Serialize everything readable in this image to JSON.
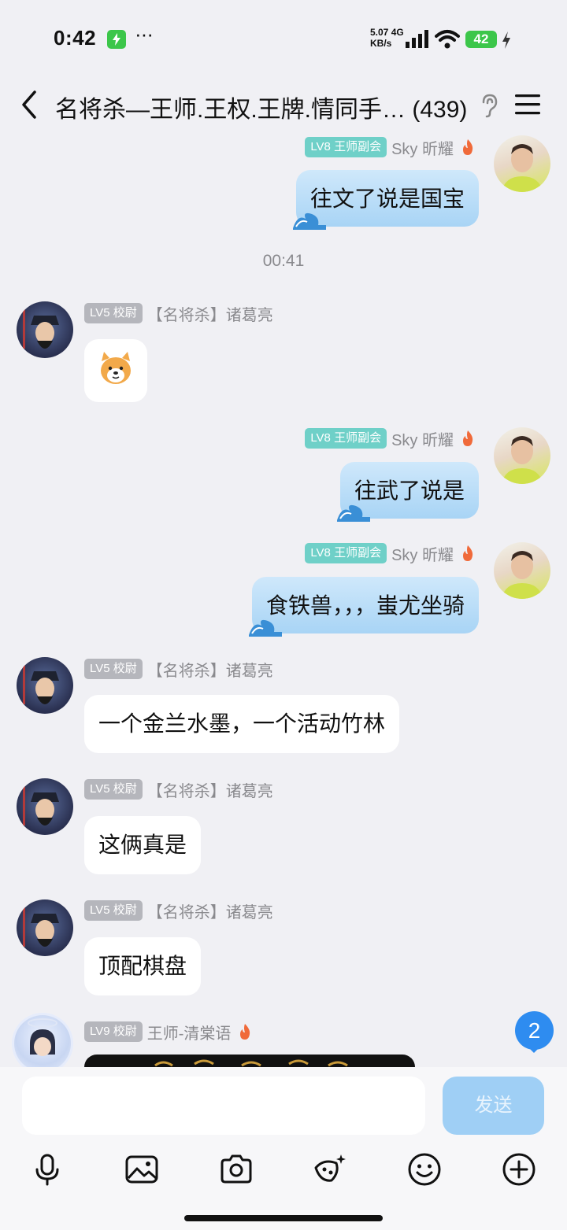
{
  "status_bar": {
    "time": "0:42",
    "dots": "···",
    "net_speed_value": "5.07",
    "net_speed_unit": "KB/s",
    "network_type": "4G",
    "battery": "42"
  },
  "header": {
    "title": "名将杀—王师.王权.王牌.情同手…",
    "member_count": "(439)"
  },
  "timestamp": "00:41",
  "users": {
    "sky": {
      "level": "LV8",
      "rank": "王师副会",
      "name": "Sky 昕耀"
    },
    "zhuge": {
      "level": "LV5",
      "rank": "校尉",
      "name": "【名将杀】诸葛亮"
    },
    "qing": {
      "level": "LV9",
      "rank": "校尉",
      "name": "王师-清棠语"
    }
  },
  "messages": {
    "m1": "往文了说是国宝",
    "m3": "往武了说是",
    "m4": "食铁兽，，，蚩尤坐骑",
    "m5": "一个金兰水墨，一个活动竹林",
    "m6": "这俩真是",
    "m7": "顶配棋盘"
  },
  "unread_badge": "2",
  "composer": {
    "input_value": "",
    "send_label": "发送"
  },
  "toolbar_icons": [
    "microphone-icon",
    "image-icon",
    "camera-icon",
    "magic-icon",
    "emoji-icon",
    "plus-icon"
  ],
  "colors": {
    "background": "#f0f0f4",
    "outgoing_bubble": "#a8d4f5",
    "incoming_bubble": "#ffffff",
    "level_badge_grey": "#b5b6bc",
    "level_badge_teal": "#6fd0c8",
    "send_button": "#9fcff5",
    "unread_badge": "#2e8cf0",
    "charging": "#3cc64a"
  }
}
